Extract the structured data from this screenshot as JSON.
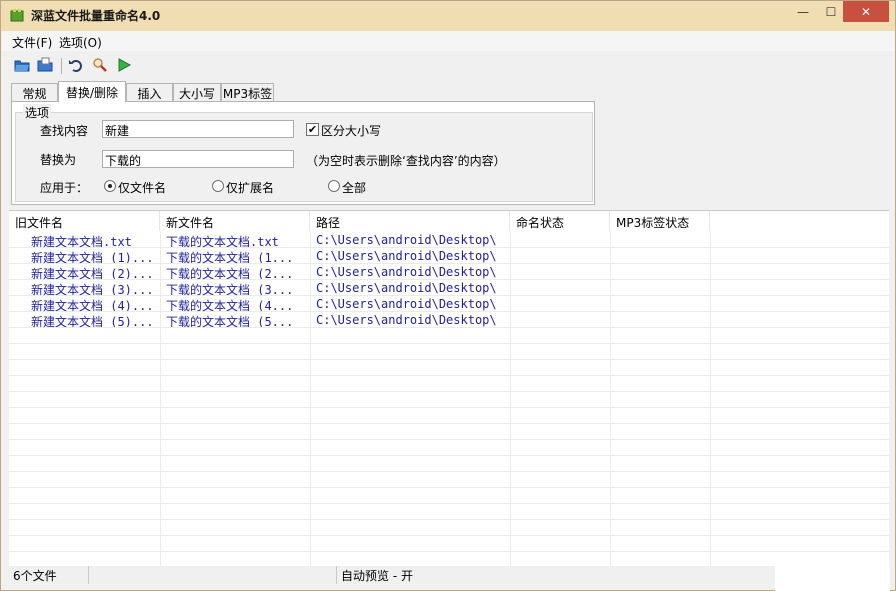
{
  "window": {
    "title": "深蓝文件批量重命名4.0"
  },
  "titlebar_buttons": {
    "minimize": "—",
    "maximize": "☐",
    "close": "✕"
  },
  "menu": {
    "items": [
      {
        "label": "文件(F)"
      },
      {
        "label": "选项(O)"
      }
    ]
  },
  "toolbar": {
    "icons": [
      "open-folder-icon",
      "save-icon",
      "undo-icon",
      "search-icon",
      "run-icon"
    ]
  },
  "tabs": [
    {
      "label": "常规",
      "active": false
    },
    {
      "label": "替换/删除",
      "active": true
    },
    {
      "label": "插入",
      "active": false
    },
    {
      "label": "大小写",
      "active": false
    },
    {
      "label": "MP3标签",
      "active": false
    }
  ],
  "options": {
    "legend": "选项",
    "find_label": "查找内容",
    "find_value": "新建",
    "case_sensitive_label": "区分大小写",
    "case_sensitive_checked": true,
    "replace_label": "替换为",
    "replace_value": "下载的",
    "replace_hint": "（为空时表示删除‘查找内容’的内容）",
    "apply_label": "应用于：",
    "apply_options": [
      {
        "label": "仅文件名",
        "selected": true
      },
      {
        "label": "仅扩展名",
        "selected": false
      },
      {
        "label": "全部",
        "selected": false
      }
    ]
  },
  "table": {
    "columns": [
      "旧文件名",
      "新文件名",
      "路径",
      "命名状态",
      "MP3标签状态"
    ],
    "rows": [
      [
        "新建文本文档.txt",
        "下载的文本文档.txt",
        "C:\\Users\\android\\Desktop\\",
        "",
        ""
      ],
      [
        "新建文本文档 (1)...",
        "下载的文本文档 (1...",
        "C:\\Users\\android\\Desktop\\",
        "",
        ""
      ],
      [
        "新建文本文档 (2)...",
        "下载的文本文档 (2...",
        "C:\\Users\\android\\Desktop\\",
        "",
        ""
      ],
      [
        "新建文本文档 (3)...",
        "下载的文本文档 (3...",
        "C:\\Users\\android\\Desktop\\",
        "",
        ""
      ],
      [
        "新建文本文档 (4)...",
        "下载的文本文档 (4...",
        "C:\\Users\\android\\Desktop\\",
        "",
        ""
      ],
      [
        "新建文本文档 (5)...",
        "下载的文本文档 (5...",
        "C:\\Users\\android\\Desktop\\",
        "",
        ""
      ]
    ]
  },
  "status": {
    "file_count": "6个文件",
    "preview": "自动预览 - 开"
  }
}
